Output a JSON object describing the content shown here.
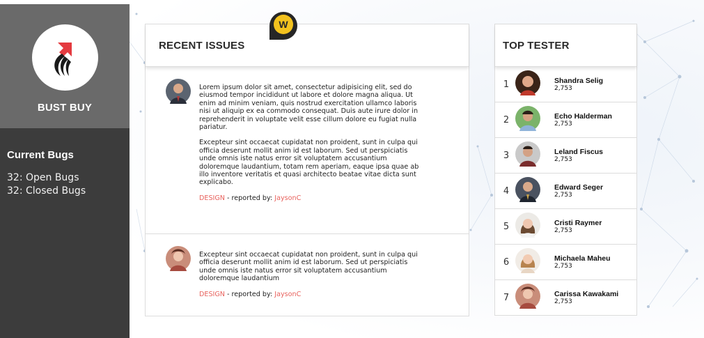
{
  "sidebar": {
    "brand_name": "BUST BUY",
    "bugs_title": "Current Bugs",
    "open_bugs": "32: Open Bugs",
    "closed_bugs": "32: Closed Bugs"
  },
  "badge": {
    "letter": "W"
  },
  "issues": {
    "title": "RECENT ISSUES",
    "items": [
      {
        "paragraphs": [
          "Lorem ipsum dolor sit amet, consectetur adipisicing elit, sed do eiusmod tempor incididunt ut labore et dolore magna aliqua. Ut enim ad minim veniam, quis nostrud exercitation ullamco laboris nisi ut aliquip ex ea commodo consequat. Duis aute irure dolor in reprehenderit in voluptate velit esse cillum dolore eu fugiat nulla pariatur.",
          "Excepteur sint occaecat cupidatat non proident, sunt in culpa qui officia deserunt mollit anim id est laborum. Sed ut perspiciatis unde omnis iste natus error sit voluptatem accusantium doloremque laudantium, totam rem aperiam, eaque ipsa quae ab illo inventore veritatis et quasi architecto beatae vitae dicta sunt explicabo."
        ],
        "tag": "DESIGN",
        "separator": " - reported by: ",
        "user": "JaysonC"
      },
      {
        "paragraphs": [
          "Excepteur sint occaecat cupidatat non proident, sunt in culpa qui officia deserunt mollit anim id est laborum. Sed ut perspiciatis unde omnis iste natus error sit voluptatem accusantium doloremque laudantium"
        ],
        "tag": "DESIGN",
        "separator": " - reported by: ",
        "user": "JaysonC"
      }
    ]
  },
  "testers": {
    "title": "TOP TESTER",
    "items": [
      {
        "rank": "1",
        "name": "Shandra Selig",
        "score": "2,753"
      },
      {
        "rank": "2",
        "name": "Echo Halderman",
        "score": "2,753"
      },
      {
        "rank": "3",
        "name": "Leland Fiscus",
        "score": "2,753"
      },
      {
        "rank": "4",
        "name": "Edward Seger",
        "score": "2,753"
      },
      {
        "rank": "5",
        "name": "Cristi Raymer",
        "score": "2,753"
      },
      {
        "rank": "6",
        "name": "Michaela Maheu",
        "score": "2,753"
      },
      {
        "rank": "7",
        "name": "Carissa Kawakami",
        "score": "2,753"
      }
    ]
  },
  "colors": {
    "sidebar_bg": "#3c3c3c",
    "brand_bg": "#6a6a6a",
    "accent_tag": "#e8625d",
    "badge_yellow": "#f3c21e",
    "logo_red": "#e43a3f"
  }
}
